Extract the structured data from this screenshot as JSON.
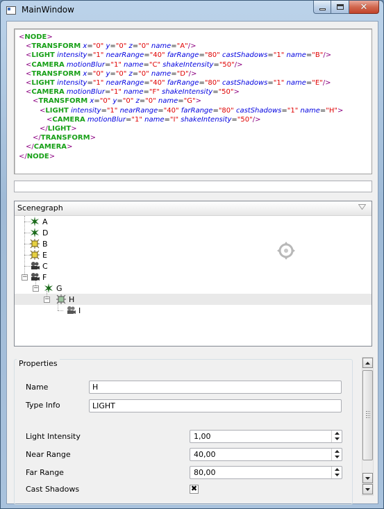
{
  "window": {
    "title": "MainWindow"
  },
  "xml": {
    "lines": [
      {
        "indent": 0,
        "parts": [
          [
            "lt",
            "<"
          ],
          [
            "tg",
            "NODE"
          ],
          [
            "lt",
            ">"
          ]
        ]
      },
      {
        "indent": 1,
        "parts": [
          [
            "lt",
            "<"
          ],
          [
            "tg",
            "TRANSFORM"
          ],
          [
            "sp",
            " "
          ],
          [
            "an",
            "x"
          ],
          [
            "eq",
            "="
          ],
          [
            "av",
            "\"0\""
          ],
          [
            "sp",
            " "
          ],
          [
            "an",
            "y"
          ],
          [
            "eq",
            "="
          ],
          [
            "av",
            "\"0\""
          ],
          [
            "sp",
            " "
          ],
          [
            "an",
            "z"
          ],
          [
            "eq",
            "="
          ],
          [
            "av",
            "\"0\""
          ],
          [
            "sp",
            " "
          ],
          [
            "an",
            "name"
          ],
          [
            "eq",
            "="
          ],
          [
            "av",
            "\"A\""
          ],
          [
            "lt",
            "/>"
          ]
        ]
      },
      {
        "indent": 1,
        "parts": [
          [
            "lt",
            "<"
          ],
          [
            "tg",
            "LIGHT"
          ],
          [
            "sp",
            " "
          ],
          [
            "an",
            "intensity"
          ],
          [
            "eq",
            "="
          ],
          [
            "av",
            "\"1\""
          ],
          [
            "sp",
            " "
          ],
          [
            "an",
            "nearRange"
          ],
          [
            "eq",
            "="
          ],
          [
            "av",
            "\"40\""
          ],
          [
            "sp",
            " "
          ],
          [
            "an",
            "farRange"
          ],
          [
            "eq",
            "="
          ],
          [
            "av",
            "\"80\""
          ],
          [
            "sp",
            " "
          ],
          [
            "an",
            "castShadows"
          ],
          [
            "eq",
            "="
          ],
          [
            "av",
            "\"1\""
          ],
          [
            "sp",
            " "
          ],
          [
            "an",
            "name"
          ],
          [
            "eq",
            "="
          ],
          [
            "av",
            "\"B\""
          ],
          [
            "lt",
            "/>"
          ]
        ]
      },
      {
        "indent": 1,
        "parts": [
          [
            "lt",
            "<"
          ],
          [
            "tg",
            "CAMERA"
          ],
          [
            "sp",
            " "
          ],
          [
            "an",
            "motionBlur"
          ],
          [
            "eq",
            "="
          ],
          [
            "av",
            "\"1\""
          ],
          [
            "sp",
            " "
          ],
          [
            "an",
            "name"
          ],
          [
            "eq",
            "="
          ],
          [
            "av",
            "\"C\""
          ],
          [
            "sp",
            " "
          ],
          [
            "an",
            "shakeIntensity"
          ],
          [
            "eq",
            "="
          ],
          [
            "av",
            "\"50\""
          ],
          [
            "lt",
            "/>"
          ]
        ]
      },
      {
        "indent": 1,
        "parts": [
          [
            "lt",
            "<"
          ],
          [
            "tg",
            "TRANSFORM"
          ],
          [
            "sp",
            " "
          ],
          [
            "an",
            "x"
          ],
          [
            "eq",
            "="
          ],
          [
            "av",
            "\"0\""
          ],
          [
            "sp",
            " "
          ],
          [
            "an",
            "y"
          ],
          [
            "eq",
            "="
          ],
          [
            "av",
            "\"0\""
          ],
          [
            "sp",
            " "
          ],
          [
            "an",
            "z"
          ],
          [
            "eq",
            "="
          ],
          [
            "av",
            "\"0\""
          ],
          [
            "sp",
            " "
          ],
          [
            "an",
            "name"
          ],
          [
            "eq",
            "="
          ],
          [
            "av",
            "\"D\""
          ],
          [
            "lt",
            "/>"
          ]
        ]
      },
      {
        "indent": 1,
        "parts": [
          [
            "lt",
            "<"
          ],
          [
            "tg",
            "LIGHT"
          ],
          [
            "sp",
            " "
          ],
          [
            "an",
            "intensity"
          ],
          [
            "eq",
            "="
          ],
          [
            "av",
            "\"1\""
          ],
          [
            "sp",
            " "
          ],
          [
            "an",
            "nearRange"
          ],
          [
            "eq",
            "="
          ],
          [
            "av",
            "\"40\""
          ],
          [
            "sp",
            " "
          ],
          [
            "an",
            "farRange"
          ],
          [
            "eq",
            "="
          ],
          [
            "av",
            "\"80\""
          ],
          [
            "sp",
            " "
          ],
          [
            "an",
            "castShadows"
          ],
          [
            "eq",
            "="
          ],
          [
            "av",
            "\"1\""
          ],
          [
            "sp",
            " "
          ],
          [
            "an",
            "name"
          ],
          [
            "eq",
            "="
          ],
          [
            "av",
            "\"E\""
          ],
          [
            "lt",
            "/>"
          ]
        ]
      },
      {
        "indent": 1,
        "parts": [
          [
            "lt",
            "<"
          ],
          [
            "tg",
            "CAMERA"
          ],
          [
            "sp",
            " "
          ],
          [
            "an",
            "motionBlur"
          ],
          [
            "eq",
            "="
          ],
          [
            "av",
            "\"1\""
          ],
          [
            "sp",
            " "
          ],
          [
            "an",
            "name"
          ],
          [
            "eq",
            "="
          ],
          [
            "av",
            "\"F\""
          ],
          [
            "sp",
            " "
          ],
          [
            "an",
            "shakeIntensity"
          ],
          [
            "eq",
            "="
          ],
          [
            "av",
            "\"50\""
          ],
          [
            "lt",
            ">"
          ]
        ]
      },
      {
        "indent": 2,
        "parts": [
          [
            "lt",
            "<"
          ],
          [
            "tg",
            "TRANSFORM"
          ],
          [
            "sp",
            " "
          ],
          [
            "an",
            "x"
          ],
          [
            "eq",
            "="
          ],
          [
            "av",
            "\"0\""
          ],
          [
            "sp",
            " "
          ],
          [
            "an",
            "y"
          ],
          [
            "eq",
            "="
          ],
          [
            "av",
            "\"0\""
          ],
          [
            "sp",
            " "
          ],
          [
            "an",
            "z"
          ],
          [
            "eq",
            "="
          ],
          [
            "av",
            "\"0\""
          ],
          [
            "sp",
            " "
          ],
          [
            "an",
            "name"
          ],
          [
            "eq",
            "="
          ],
          [
            "av",
            "\"G\""
          ],
          [
            "lt",
            ">"
          ]
        ]
      },
      {
        "indent": 3,
        "parts": [
          [
            "lt",
            "<"
          ],
          [
            "tg",
            "LIGHT"
          ],
          [
            "sp",
            " "
          ],
          [
            "an",
            "intensity"
          ],
          [
            "eq",
            "="
          ],
          [
            "av",
            "\"1\""
          ],
          [
            "sp",
            " "
          ],
          [
            "an",
            "nearRange"
          ],
          [
            "eq",
            "="
          ],
          [
            "av",
            "\"40\""
          ],
          [
            "sp",
            " "
          ],
          [
            "an",
            "farRange"
          ],
          [
            "eq",
            "="
          ],
          [
            "av",
            "\"80\""
          ],
          [
            "sp",
            " "
          ],
          [
            "an",
            "castShadows"
          ],
          [
            "eq",
            "="
          ],
          [
            "av",
            "\"1\""
          ],
          [
            "sp",
            " "
          ],
          [
            "an",
            "name"
          ],
          [
            "eq",
            "="
          ],
          [
            "av",
            "\"H\""
          ],
          [
            "lt",
            ">"
          ]
        ]
      },
      {
        "indent": 4,
        "parts": [
          [
            "lt",
            "<"
          ],
          [
            "tg",
            "CAMERA"
          ],
          [
            "sp",
            " "
          ],
          [
            "an",
            "motionBlur"
          ],
          [
            "eq",
            "="
          ],
          [
            "av",
            "\"1\""
          ],
          [
            "sp",
            " "
          ],
          [
            "an",
            "name"
          ],
          [
            "eq",
            "="
          ],
          [
            "av",
            "\"I\""
          ],
          [
            "sp",
            " "
          ],
          [
            "an",
            "shakeIntensity"
          ],
          [
            "eq",
            "="
          ],
          [
            "av",
            "\"50\""
          ],
          [
            "lt",
            "/>"
          ]
        ]
      },
      {
        "indent": 3,
        "parts": [
          [
            "lt",
            "</"
          ],
          [
            "tg",
            "LIGHT"
          ],
          [
            "lt",
            ">"
          ]
        ]
      },
      {
        "indent": 2,
        "parts": [
          [
            "lt",
            "</"
          ],
          [
            "tg",
            "TRANSFORM"
          ],
          [
            "lt",
            ">"
          ]
        ]
      },
      {
        "indent": 1,
        "parts": [
          [
            "lt",
            "</"
          ],
          [
            "tg",
            "CAMERA"
          ],
          [
            "lt",
            ">"
          ]
        ]
      },
      {
        "indent": 0,
        "parts": [
          [
            "lt",
            "</"
          ],
          [
            "tg",
            "NODE"
          ],
          [
            "lt",
            ">"
          ]
        ]
      }
    ]
  },
  "search": {
    "value": ""
  },
  "scenegraph": {
    "header": "Scenegraph",
    "nodes": [
      {
        "label": "A",
        "icon": "transform-icon"
      },
      {
        "label": "D",
        "icon": "transform-icon"
      },
      {
        "label": "B",
        "icon": "light-icon"
      },
      {
        "label": "E",
        "icon": "light-icon"
      },
      {
        "label": "C",
        "icon": "camera-icon"
      },
      {
        "label": "F",
        "icon": "camera-icon"
      },
      {
        "label": "G",
        "icon": "transform-icon"
      },
      {
        "label": "H",
        "icon": "light-icon"
      },
      {
        "label": "I",
        "icon": "camera-icon"
      }
    ],
    "selected": "H"
  },
  "properties": {
    "title": "Properties",
    "name_label": "Name",
    "name_value": "H",
    "type_label": "Type Info",
    "type_value": "LIGHT",
    "intensity_label": "Light Intensity",
    "intensity_value": "1,00",
    "near_label": "Near Range",
    "near_value": "40,00",
    "far_label": "Far Range",
    "far_value": "80,00",
    "shadows_label": "Cast Shadows",
    "shadows_checked": true
  }
}
